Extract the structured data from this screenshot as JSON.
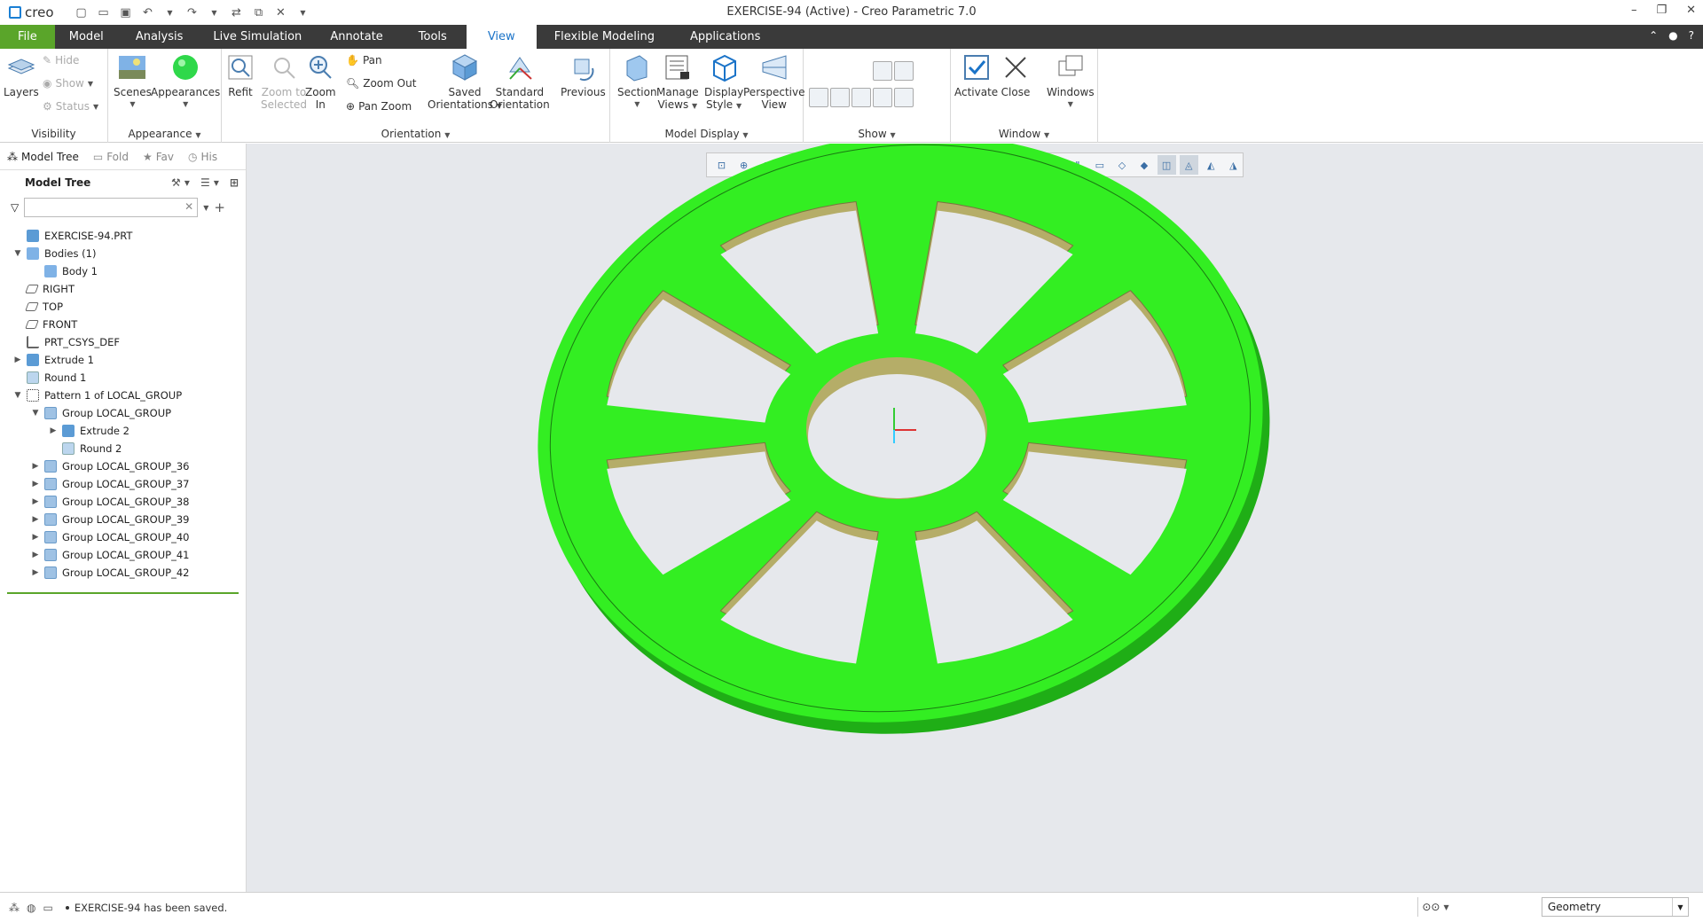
{
  "app": {
    "logo_text": "creo",
    "window_title": "EXERCISE-94 (Active) - Creo Parametric 7.0"
  },
  "menu_tabs": [
    "File",
    "Model",
    "Analysis",
    "Live Simulation",
    "Annotate",
    "Tools",
    "View",
    "Flexible Modeling",
    "Applications"
  ],
  "active_tab": "View",
  "ribbon": {
    "visibility": {
      "label": "Visibility",
      "layers": "Layers",
      "hide": "Hide",
      "show": "Show",
      "status": "Status"
    },
    "appearance": {
      "label": "Appearance",
      "scenes": "Scenes",
      "appearances": "Appearances"
    },
    "orientation": {
      "label": "Orientation",
      "refit": "Refit",
      "zoom_to_selected_1": "Zoom to",
      "zoom_to_selected_2": "Selected",
      "zoom_in_1": "Zoom",
      "zoom_in_2": "In",
      "pan": "Pan",
      "zoom_out": "Zoom Out",
      "pan_zoom": "Pan Zoom",
      "saved_1": "Saved",
      "saved_2": "Orientations",
      "standard_1": "Standard",
      "standard_2": "Orientation",
      "previous": "Previous"
    },
    "model_display": {
      "label": "Model Display",
      "section": "Section",
      "manage_1": "Manage",
      "manage_2": "Views",
      "display_1": "Display",
      "display_2": "Style",
      "persp_1": "Perspective",
      "persp_2": "View"
    },
    "show": {
      "label": "Show"
    },
    "window": {
      "label": "Window",
      "activate": "Activate",
      "close": "Close",
      "windows": "Windows"
    }
  },
  "navigator": {
    "tabs": [
      "Model Tree",
      "Fold",
      "Fav",
      "His"
    ],
    "tree_title": "Model Tree",
    "search_placeholder": ""
  },
  "model_tree": [
    {
      "label": "EXERCISE-94.PRT",
      "indent": 0,
      "expander": "",
      "icon": "part-icon"
    },
    {
      "label": "Bodies (1)",
      "indent": 0,
      "expander": "▼",
      "icon": "bodies-icon"
    },
    {
      "label": "Body 1",
      "indent": 1,
      "expander": "",
      "icon": "body-icon"
    },
    {
      "label": "RIGHT",
      "indent": 0,
      "expander": "",
      "icon": "datum-plane-icon"
    },
    {
      "label": "TOP",
      "indent": 0,
      "expander": "",
      "icon": "datum-plane-icon"
    },
    {
      "label": "FRONT",
      "indent": 0,
      "expander": "",
      "icon": "datum-plane-icon"
    },
    {
      "label": "PRT_CSYS_DEF",
      "indent": 0,
      "expander": "",
      "icon": "csys-icon"
    },
    {
      "label": "Extrude 1",
      "indent": 0,
      "expander": "▶",
      "icon": "extrude-icon"
    },
    {
      "label": "Round 1",
      "indent": 0,
      "expander": "",
      "icon": "round-icon"
    },
    {
      "label": "Pattern 1 of LOCAL_GROUP",
      "indent": 0,
      "expander": "▼",
      "icon": "pattern-icon"
    },
    {
      "label": "Group LOCAL_GROUP",
      "indent": 1,
      "expander": "▼",
      "icon": "group-icon"
    },
    {
      "label": "Extrude 2",
      "indent": 2,
      "expander": "▶",
      "icon": "extrude-icon"
    },
    {
      "label": "Round 2",
      "indent": 2,
      "expander": "",
      "icon": "round-icon"
    },
    {
      "label": "Group LOCAL_GROUP_36",
      "indent": 1,
      "expander": "▶",
      "icon": "group-icon"
    },
    {
      "label": "Group LOCAL_GROUP_37",
      "indent": 1,
      "expander": "▶",
      "icon": "group-icon"
    },
    {
      "label": "Group LOCAL_GROUP_38",
      "indent": 1,
      "expander": "▶",
      "icon": "group-icon"
    },
    {
      "label": "Group LOCAL_GROUP_39",
      "indent": 1,
      "expander": "▶",
      "icon": "group-icon"
    },
    {
      "label": "Group LOCAL_GROUP_40",
      "indent": 1,
      "expander": "▶",
      "icon": "group-icon"
    },
    {
      "label": "Group LOCAL_GROUP_41",
      "indent": 1,
      "expander": "▶",
      "icon": "group-icon"
    },
    {
      "label": "Group LOCAL_GROUP_42",
      "indent": 1,
      "expander": "▶",
      "icon": "group-icon"
    }
  ],
  "status": {
    "message": "EXERCISE-94 has been saved.",
    "filter_value": "Geometry"
  },
  "colors": {
    "file_tab": "#5aa52a",
    "model_green": "#33ee22",
    "accent_blue": "#1a73c8"
  }
}
